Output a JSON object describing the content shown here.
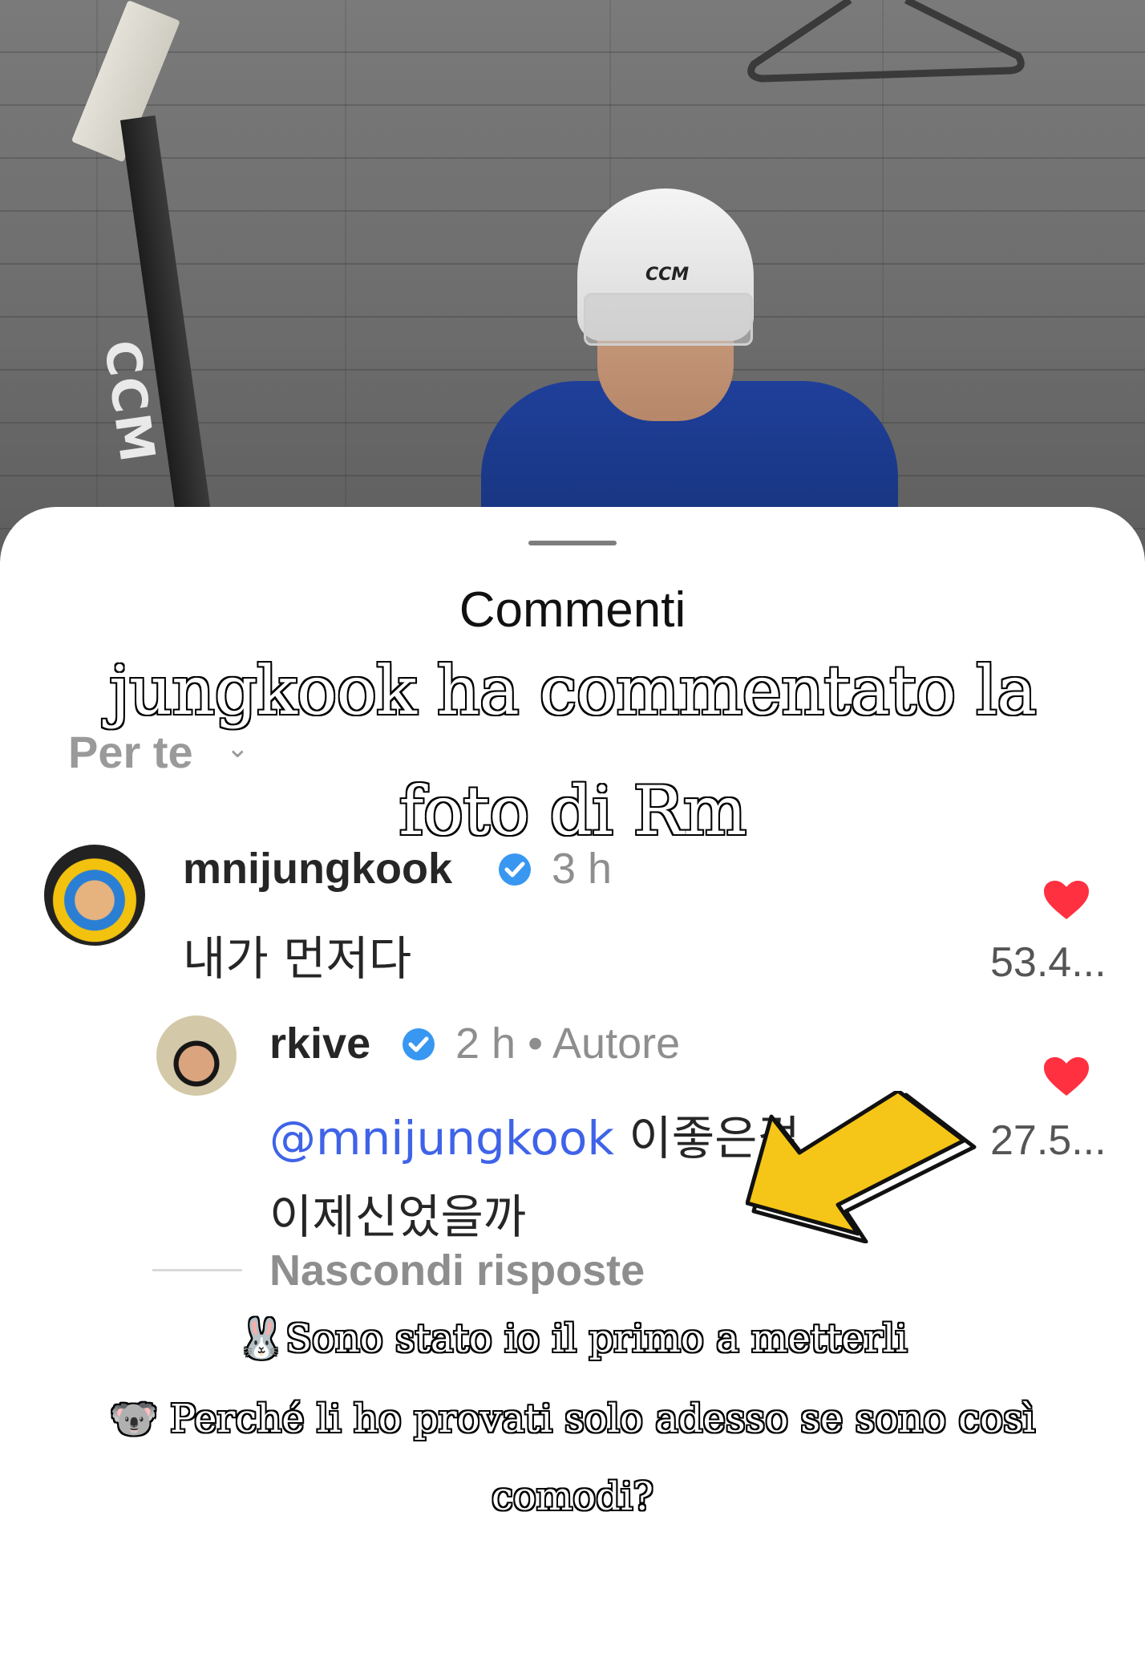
{
  "sheet": {
    "title": "Commenti",
    "sort_label": "Per te",
    "sort_icon": "chevron-down-icon"
  },
  "overlay": {
    "title_line1": "jungkook ha commentato la",
    "title_line2": "foto di Rm"
  },
  "comments": [
    {
      "username": "mnijungkook",
      "verified": true,
      "time": "3 h",
      "text": "내가 먼저다",
      "likes": "53.4..."
    }
  ],
  "reply": {
    "username": "rkive",
    "verified": true,
    "time": "2 h",
    "separator": "•",
    "role": "Autore",
    "mention": "@mnijungkook",
    "text_after_mention": "이좋은걸",
    "text_line2": "이제신었을까",
    "likes": "27.5..."
  },
  "hide_replies": "Nascondi risposte",
  "captions": [
    {
      "emoji": "🐰",
      "text": "Sono stato io il primo a metterli"
    },
    {
      "emoji": "🐨",
      "text": "Perché li ho provati solo adesso se sono così"
    },
    {
      "emoji": "",
      "text": "comodi?"
    }
  ],
  "colors": {
    "heart": "#ff3040",
    "verified": "#3897f0",
    "mention": "#3f63e8",
    "arrow": "#f5c518"
  },
  "photo": {
    "helmet_brand": "CCM",
    "stick_brand": "CCM"
  }
}
